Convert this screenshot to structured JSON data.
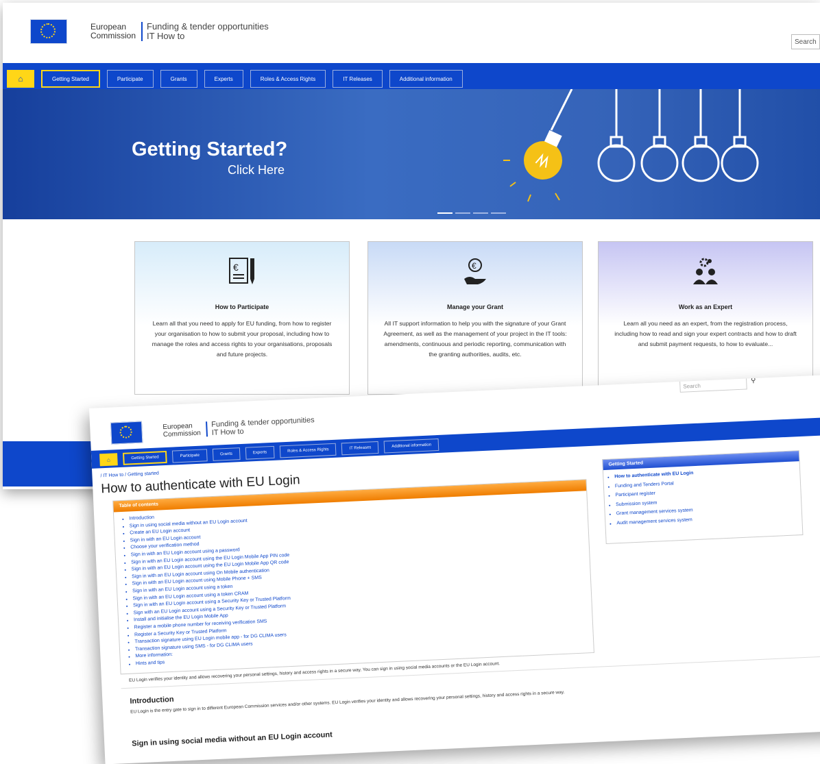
{
  "brand": {
    "ec_line1": "European",
    "ec_line2": "Commission",
    "site_line1": "Funding & tender opportunities",
    "site_line2": "IT How to"
  },
  "search": {
    "placeholder": "Search"
  },
  "nav": {
    "home_icon": "home-icon",
    "items": [
      "Getting Started",
      "Participate",
      "Grants",
      "Experts",
      "Roles & Access Rights",
      "IT Releases",
      "Additional information"
    ]
  },
  "hero": {
    "title": "Getting Started?",
    "subtitle": "Click Here"
  },
  "cards": [
    {
      "icon": "euro-document-icon",
      "title": "How to Participate",
      "text": "Learn all that you need to apply for EU funding, from how to register your organisation to how to submit your proposal, including how to manage the roles and access rights to your organisations, proposals and future projects."
    },
    {
      "icon": "coin-hand-icon",
      "title": "Manage your Grant",
      "text": "All IT support information to help you with the signature of your Grant Agreement, as well as the management of your project in the IT tools: amendments, continuous and periodic reporting, communication with the granting authorities, audits, etc."
    },
    {
      "icon": "experts-gear-icon",
      "title": "Work as an Expert",
      "text": "Learn all you need as an expert, from the registration process, including how to read and sign your expert contracts and how to draft and submit payment requests, to how to evaluate..."
    }
  ],
  "front": {
    "breadcrumb": "/ IT How to / Getting started",
    "title": "How to authenticate with EU Login",
    "toc_heading": "Table of contents",
    "toc": [
      "Introduction",
      "Sign in using social media without an EU Login account",
      "Create an EU Login account",
      "Sign in with an EU Login account",
      "Choose your verification method",
      "Sign in with an EU Login account using a password",
      "Sign in with an EU Login account using the EU Login Mobile App PIN code",
      "Sign in with an EU Login account using the EU Login Mobile App QR code",
      "Sign in with an EU Login account using On Mobile authentication",
      "Sign in with an EU Login account using Mobile Phone + SMS",
      "Sign in with an EU Login account using a token",
      "Sign in with an EU Login account using a token CRAM",
      "Sign in with an EU Login account using a Security Key or Trusted Platform",
      "Sign with an EU Login account using a Security Key or Trusted Platform",
      "Install and initialise the EU Login Mobile App",
      "Register a mobile phone number for receiving verification SMS",
      "Register a Security Key or Trusted Platform",
      "Transaction signature using EU Login mobile app - for DG CLIMA users",
      "Transaction signature using SMS - for DG CLIMA users",
      "More information:",
      "Hints and tips"
    ],
    "side_heading": "Getting Started",
    "side": [
      "How to authenticate with EU Login",
      "Funding and Tenders Portal",
      "Participant register",
      "Submission system",
      "Grant management services system",
      "Audit management services system"
    ],
    "lead": "EU Login verifies your identity and allows recovering your personal settings, history and access rights in a secure way. You can sign in using social media accounts or the EU Login account.",
    "intro_heading": "Introduction",
    "intro_text": "EU Login is the entry gate to sign in to different European Commission services and/or other systems. EU Login verifies your identity and allows recovering your personal settings, history and access rights in a secure way.",
    "section2": "Sign in using social media without an EU Login account"
  },
  "colors": {
    "ec_blue": "#0e47cb",
    "ec_yellow": "#ffd617",
    "toc_orange": "#ef7d00"
  }
}
